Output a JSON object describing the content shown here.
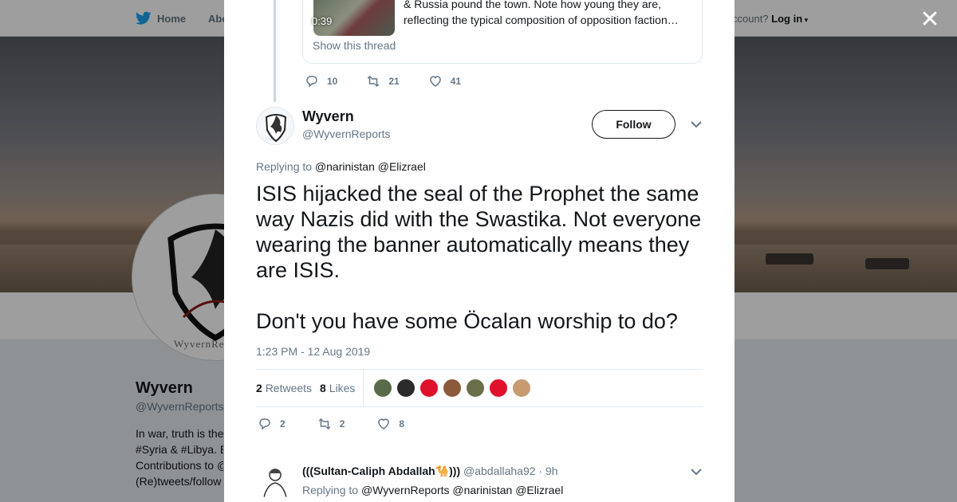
{
  "topnav": {
    "home": "Home",
    "about": "Abo",
    "account_prompt": "ccount?",
    "login": "Log in"
  },
  "profile": {
    "name": "Wyvern",
    "handle": "@WyvernReports",
    "avatar_brand_text": "WyvernRe",
    "bio_lines": [
      "In war, truth is the",
      "#Syria & #Libya. E",
      "Contributions to @",
      "(Re)tweets/follow"
    ]
  },
  "modal": {
    "previous": {
      "quote_text": "& Russia pound the town. Note how young they are, reflecting the typical composition of opposition faction…",
      "video_duration": "0:39",
      "show_thread": "Show this thread",
      "replies": "10",
      "retweets": "21",
      "likes": "41"
    },
    "tweet": {
      "author_name": "Wyvern",
      "author_handle": "@WyvernReports",
      "follow_label": "Follow",
      "replying_label": "Replying to",
      "replying_mentions": "@narinistan @Elizrael",
      "text_paragraph_1": "ISIS hijacked the seal of the Prophet the same way Nazis did with the Swastika. Not everyone wearing the banner automatically means they are ISIS.",
      "text_paragraph_2": "Don't you have some Öcalan worship to do?",
      "timestamp": "1:23 PM - 12 Aug 2019",
      "retweet_count": "2",
      "retweet_label": "Retweets",
      "like_count": "8",
      "like_label": "Likes",
      "likers": [
        {
          "color": "#5a6b4a"
        },
        {
          "color": "#2b2b2b"
        },
        {
          "color": "#e0112b"
        },
        {
          "color": "#8a5a3a"
        },
        {
          "color": "#6a6f4a"
        },
        {
          "color": "#e0112b"
        },
        {
          "color": "#c89a70"
        }
      ],
      "actions": {
        "replies": "2",
        "retweets": "2",
        "likes": "8"
      }
    },
    "reply": {
      "author_name": "(((Sultan-Caliph Abdallah🐪)))",
      "author_handle": "@abdallaha92",
      "time": "· 9h",
      "replying_label": "Replying to",
      "replying_mentions": "@WyvernReports @narinistan @Elizrael"
    }
  },
  "colors": {
    "accent": "#1da1f2",
    "muted": "#657786",
    "text": "#14171a"
  }
}
